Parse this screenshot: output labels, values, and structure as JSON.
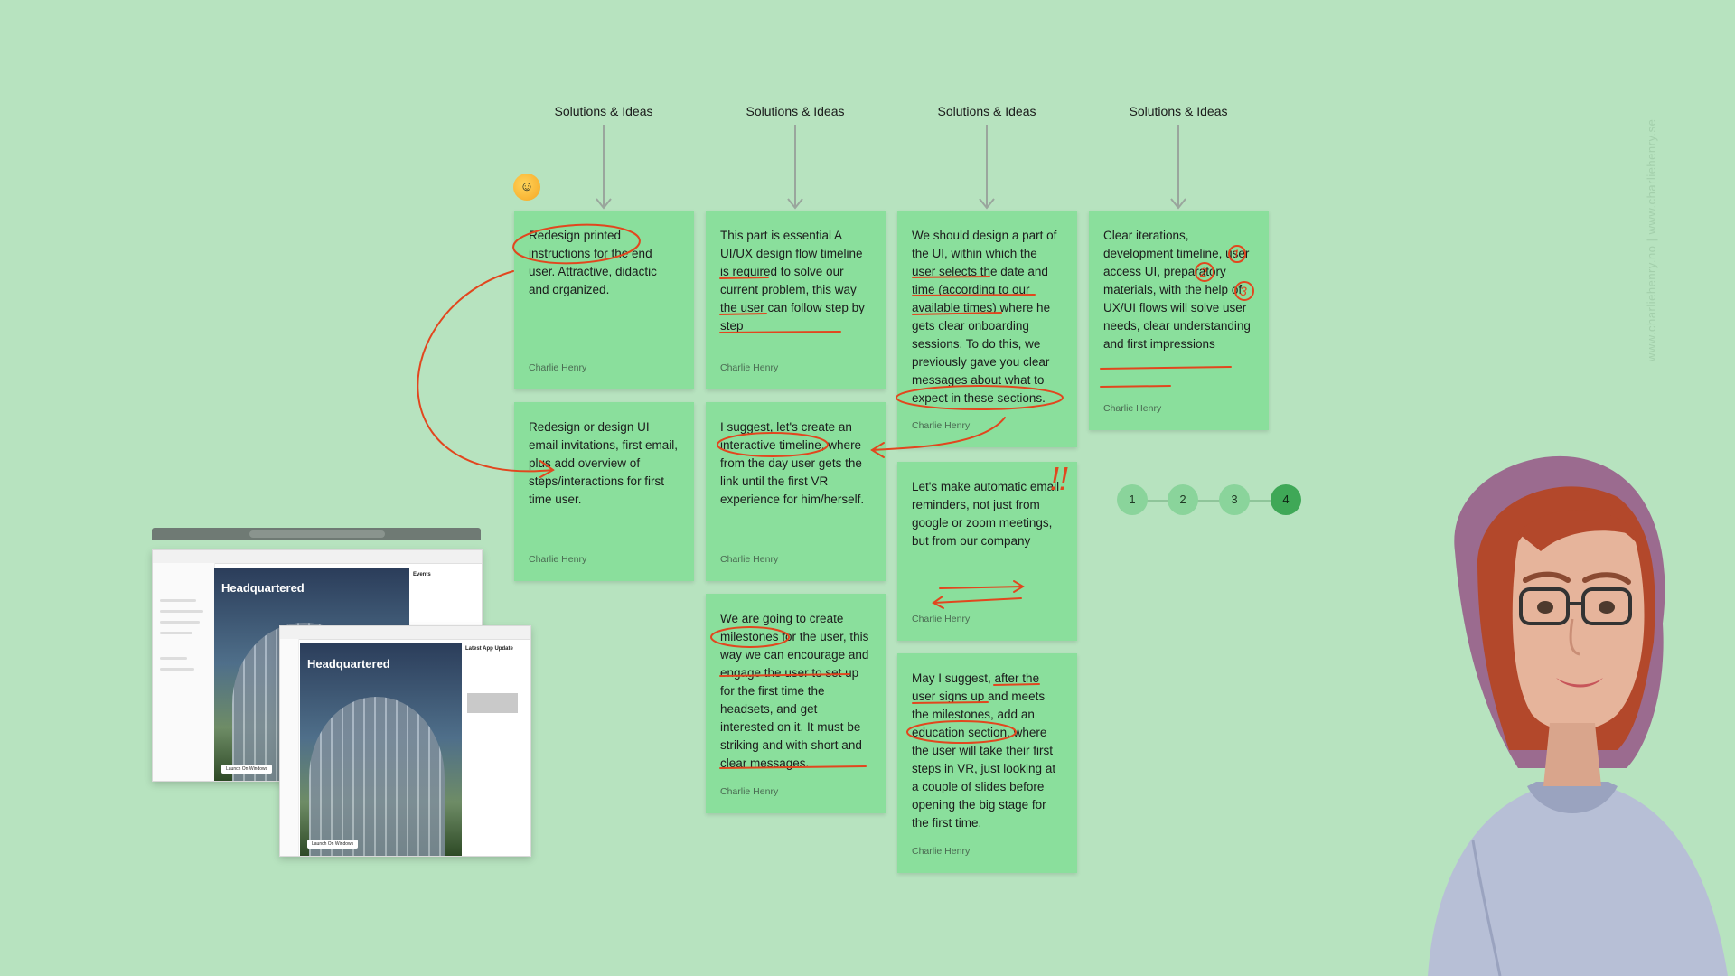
{
  "headers": [
    "Solutions & Ideas",
    "Solutions & Ideas",
    "Solutions & Ideas",
    "Solutions & Ideas"
  ],
  "notes": [
    {
      "text": "Redesign printed instructions for the end user. Attractive, didactic and organized.",
      "author": "Charlie Henry"
    },
    {
      "text": "Redesign or design UI email invitations, first email, plus add overview of steps/interactions for first time user.",
      "author": "Charlie Henry"
    },
    {
      "text": "This part is essential A UI/UX design flow timeline is required to solve our current problem, this way the user can follow step by step",
      "author": "Charlie Henry"
    },
    {
      "text": "I suggest, let's create an interactive timeline, where from the day user gets the link until the first VR experience for him/herself.",
      "author": "Charlie Henry"
    },
    {
      "text": "We are going to create milestones for the user, this way we can encourage and engage the user to set up for the first time the headsets, and get interested on it. It must be striking and with short and clear messages.",
      "author": "Charlie Henry"
    },
    {
      "text": "We should design a part of the UI, within which the user selects the date and time (according to our available times) where he gets clear onboarding sessions. To do this, we previously gave you clear messages about what to expect in these sections.",
      "author": "Charlie Henry"
    },
    {
      "text": "Let's make automatic email reminders, not just from google or zoom meetings, but from our company",
      "author": "Charlie Henry"
    },
    {
      "text": "May I suggest, after the user signs up and meets the milestones, add an education section, where the user will take their first steps in VR, just looking at a couple of slides before opening the big stage for the first time.",
      "author": "Charlie Henry"
    },
    {
      "text": "Clear iterations, development timeline, user access UI, preparatory materials, with the help of UX/UI flows will solve user needs, clear understanding and first impressions",
      "author": "Charlie Henry"
    }
  ],
  "stepper": [
    "1",
    "2",
    "3",
    "4"
  ],
  "watermark": "www.charliehenry.no | www.charliehenry.se",
  "annotations": {
    "exclaim": "!!",
    "num1": "1",
    "num2": "2",
    "num3": "3"
  },
  "mockups": {
    "back_title": "Headquartered",
    "back_panel": "Events",
    "back_launch": "Launch On Windows",
    "front_title": "Headquartered",
    "front_panel": "Latest App Update",
    "front_launch": "Launch On Windows"
  },
  "colors": {
    "background": "#b7e3bf",
    "note": "#8adf9c",
    "annotation": "#e2461e",
    "step_active": "#3fa857"
  }
}
